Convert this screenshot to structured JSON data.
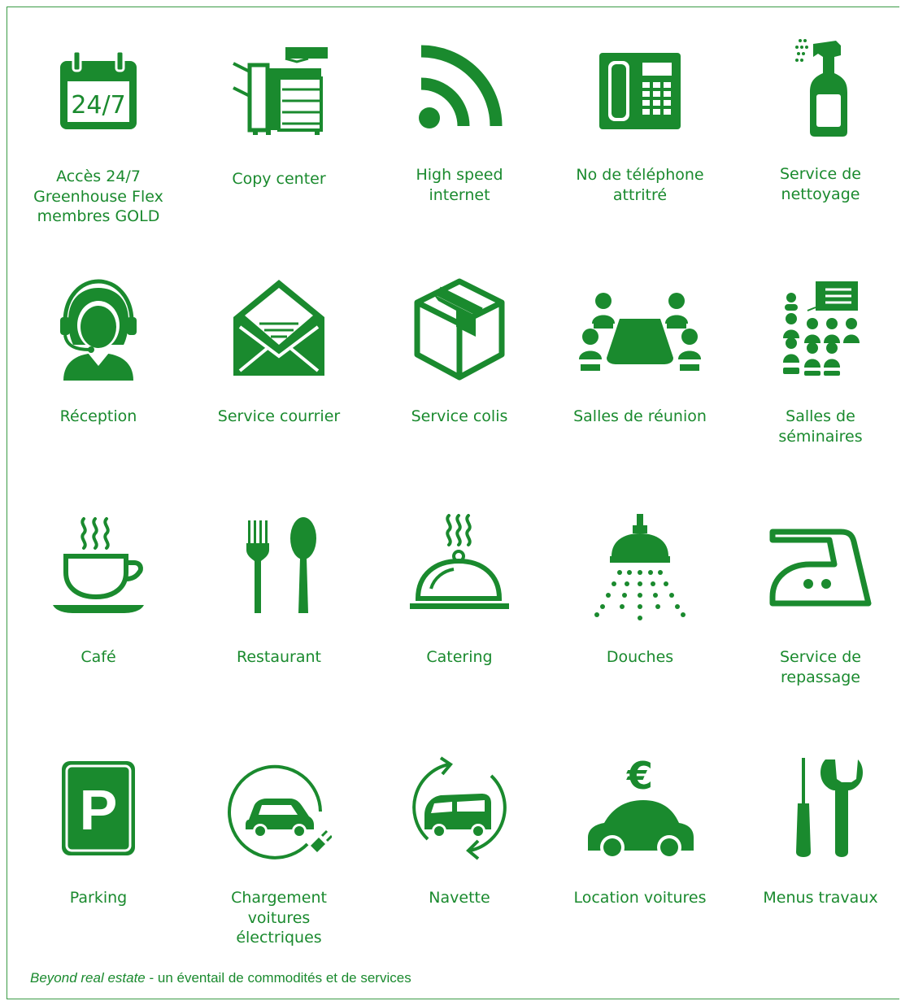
{
  "accent_color": "#1a8a2e",
  "amenities": [
    {
      "label": "Accès 24/7\nGreenhouse Flex\nmembres GOLD",
      "icon": "calendar-24-7-icon",
      "icon_text": "24/7"
    },
    {
      "label": "Copy center",
      "icon": "copier-icon"
    },
    {
      "label": "High speed\ninternet",
      "icon": "wifi-signal-icon"
    },
    {
      "label": "No de téléphone\nattritré",
      "icon": "desk-phone-icon"
    },
    {
      "label": "Service de\nnettoyage",
      "icon": "spray-bottle-icon"
    },
    {
      "label": "Réception",
      "icon": "receptionist-headset-icon"
    },
    {
      "label": "Service courrier",
      "icon": "envelope-icon"
    },
    {
      "label": "Service colis",
      "icon": "parcel-box-icon"
    },
    {
      "label": "Salles de réunion",
      "icon": "meeting-table-icon"
    },
    {
      "label": "Salles de\nséminaires",
      "icon": "seminar-audience-icon"
    },
    {
      "label": "Café",
      "icon": "coffee-cup-icon"
    },
    {
      "label": "Restaurant",
      "icon": "fork-spoon-icon"
    },
    {
      "label": "Catering",
      "icon": "cloche-icon"
    },
    {
      "label": "Douches",
      "icon": "shower-icon"
    },
    {
      "label": "Service de\nrepassage",
      "icon": "iron-icon"
    },
    {
      "label": "Parking",
      "icon": "parking-sign-icon",
      "icon_text": "P"
    },
    {
      "label": "Chargement\nvoitures\nélectriques",
      "icon": "ev-charging-icon"
    },
    {
      "label": "Navette",
      "icon": "shuttle-icon"
    },
    {
      "label": "Location voitures",
      "icon": "car-rental-icon",
      "icon_text": "€"
    },
    {
      "label": "Menus travaux",
      "icon": "tools-icon"
    }
  ],
  "footer": {
    "italic": "Beyond real estate",
    "rest": " - un éventail de commodités et de services"
  }
}
